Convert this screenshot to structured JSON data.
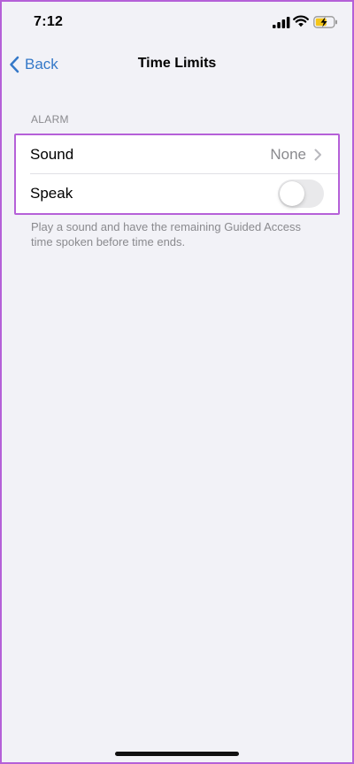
{
  "status_bar": {
    "time": "7:12",
    "icons": [
      "cellular-signal-icon",
      "wifi-icon",
      "battery-charging-icon"
    ]
  },
  "nav": {
    "back_label": "Back",
    "title": "Time Limits"
  },
  "section": {
    "header": "ALARM",
    "rows": [
      {
        "label": "Sound",
        "value": "None"
      },
      {
        "label": "Speak",
        "toggle_on": false
      }
    ],
    "footer": "Play a sound and have the remaining Guided Access time spoken before time ends."
  },
  "colors": {
    "accent": "#3478c8",
    "highlight": "#b560d8",
    "background": "#f2f2f7",
    "battery_charge": "#f5c518"
  }
}
